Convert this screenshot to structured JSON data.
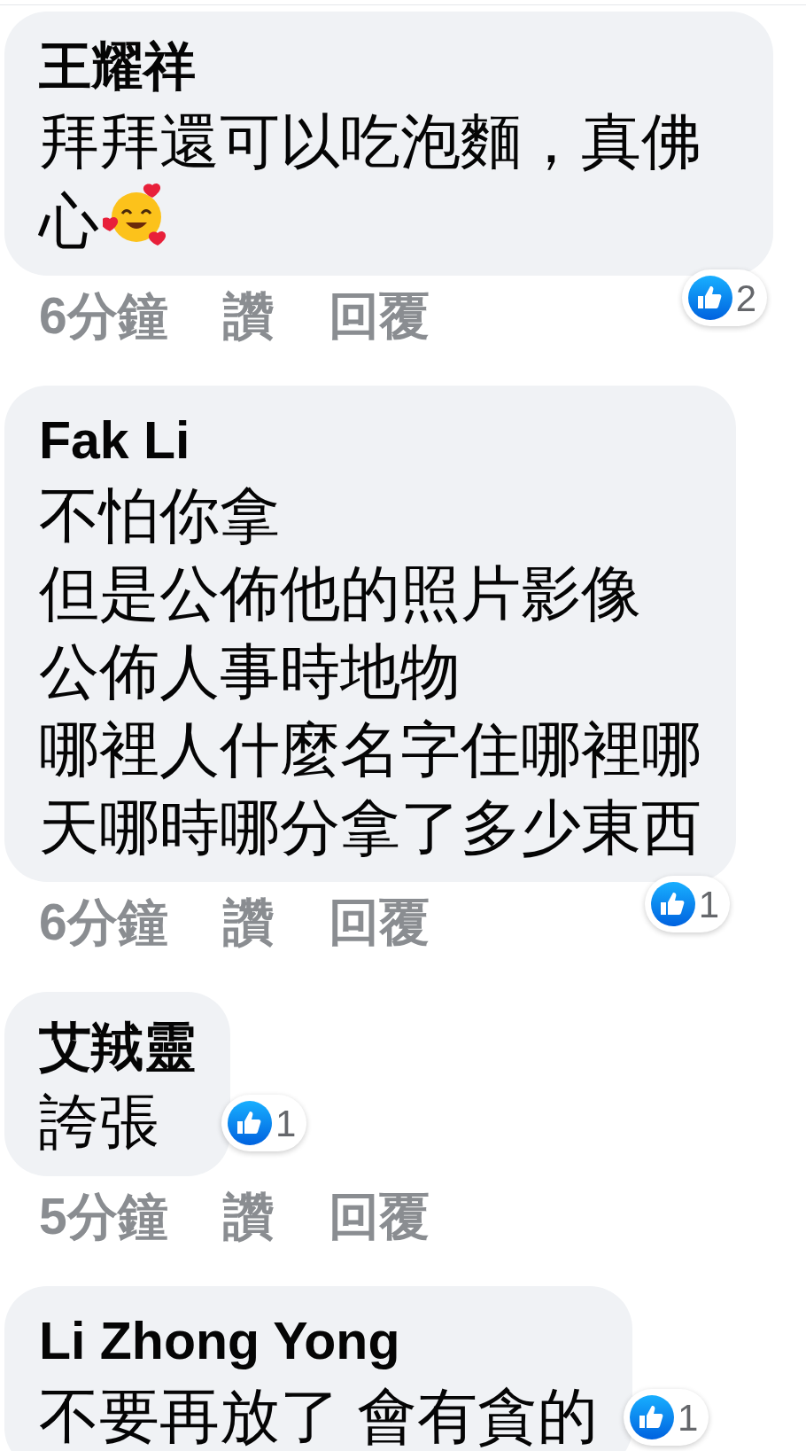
{
  "comments": [
    {
      "author": "王耀祥",
      "text": "拜拜還可以吃泡麵，真佛心",
      "time": "6分鐘",
      "like": "讚",
      "reply": "回覆",
      "reactions": "2"
    },
    {
      "author": "Fak Li",
      "lines": [
        "不怕你拿",
        "但是公佈他的照片影像",
        "公佈人事時地物",
        "哪裡人什麼名字住哪裡哪",
        "天哪時哪分拿了多少東西"
      ],
      "time": "6分鐘",
      "like": "讚",
      "reply": "回覆",
      "reactions": "1"
    },
    {
      "author": "艾羢靈",
      "text": "誇張",
      "time": "5分鐘",
      "like": "讚",
      "reply": "回覆",
      "reactions": "1"
    },
    {
      "author": "Li Zhong Yong",
      "text": "不要再放了 會有貪的",
      "reactions": "1"
    }
  ]
}
